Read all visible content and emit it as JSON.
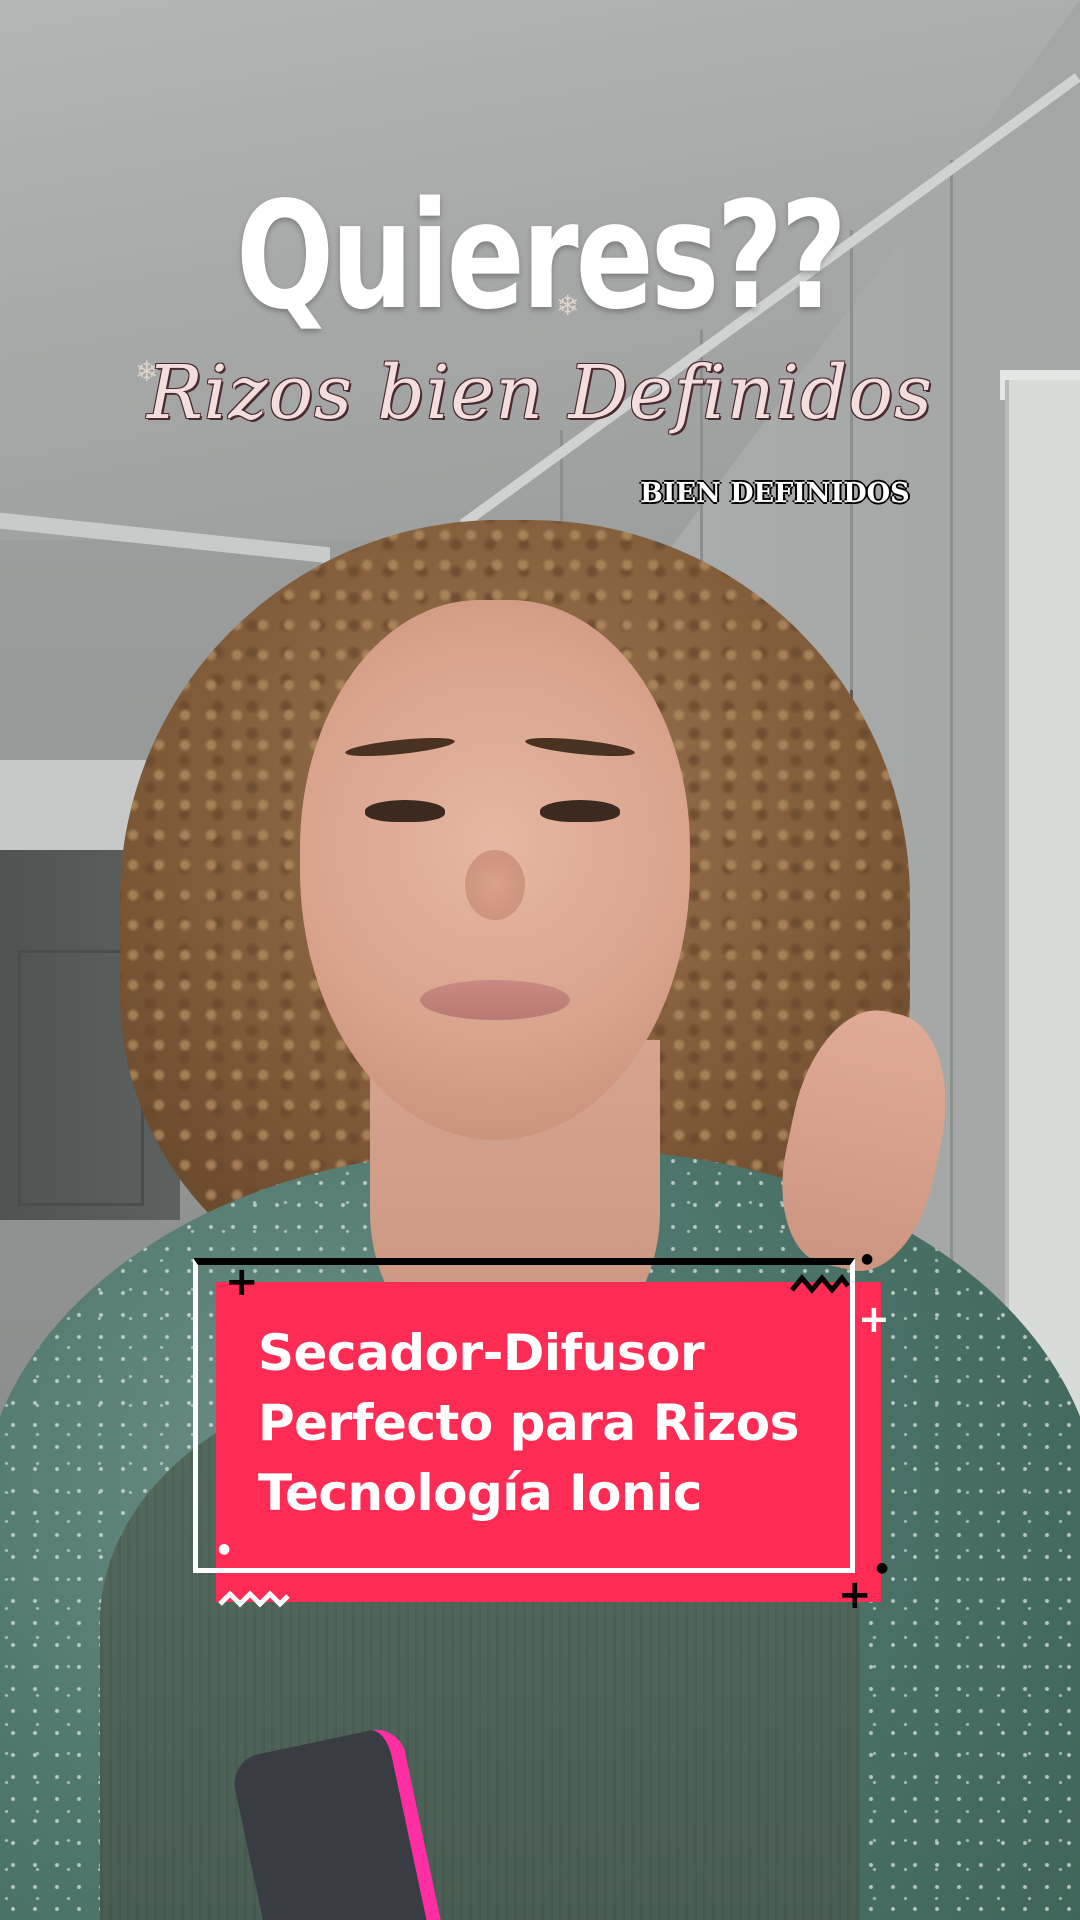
{
  "overlay": {
    "headline": "Quieres??",
    "subtitle_script": "Rizos bien Definidos",
    "caption_small": "BIEN DEFINIDOS"
  },
  "callout_box": {
    "lines": [
      "Secador-Difusor",
      "Perfecto para Rizos",
      "Tecnología Ionic"
    ],
    "fill_color": "#fe2c55",
    "text_color": "#ffffff"
  },
  "decorations": {
    "plus_glyph": "+",
    "dot_glyph": "●",
    "snowflake_glyph": "❄"
  }
}
